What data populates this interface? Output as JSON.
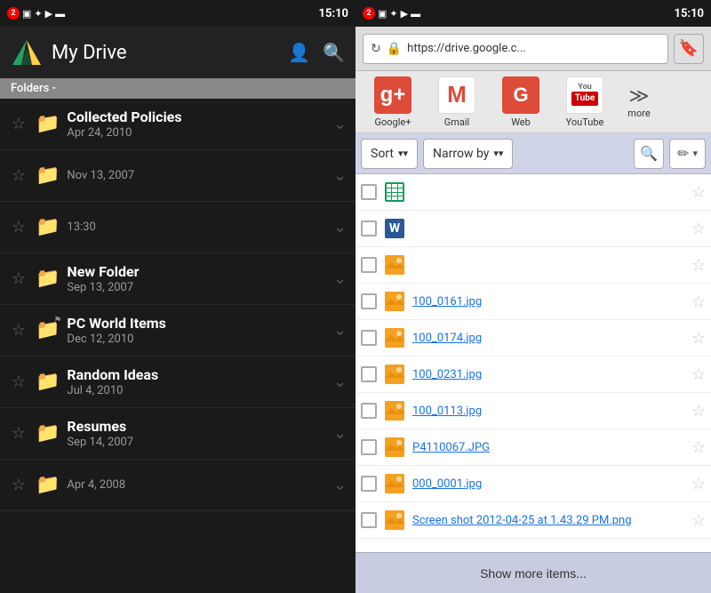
{
  "left": {
    "status_bar": {
      "badge": "2",
      "time": "15:10"
    },
    "header": {
      "title": "My Drive"
    },
    "folders_label": "Folders -",
    "folders": [
      {
        "name": "Collected Policies",
        "date": "Apr 24, 2010",
        "starred": false,
        "flagged": false
      },
      {
        "name": "",
        "date": "Nov 13, 2007",
        "starred": false,
        "flagged": false
      },
      {
        "name": "",
        "date": "13:30",
        "starred": false,
        "flagged": false
      },
      {
        "name": "New Folder",
        "date": "Sep 13, 2007",
        "starred": false,
        "flagged": false
      },
      {
        "name": "PC World Items",
        "date": "Dec 12, 2010",
        "starred": false,
        "flagged": true
      },
      {
        "name": "Random Ideas",
        "date": "Jul 4, 2010",
        "starred": false,
        "flagged": false
      },
      {
        "name": "Resumes",
        "date": "Sep 14, 2007",
        "starred": false,
        "flagged": false
      },
      {
        "name": "",
        "date": "Apr 4, 2008",
        "starred": false,
        "flagged": false
      }
    ]
  },
  "right": {
    "status_bar": {
      "badge": "2",
      "time": "15:10"
    },
    "browser": {
      "url": "https://drive.google.c...",
      "url_icon": "🔒"
    },
    "bookmarks": [
      {
        "id": "gplus",
        "label": "Google+"
      },
      {
        "id": "gmail",
        "label": "Gmail"
      },
      {
        "id": "web",
        "label": "Web"
      },
      {
        "id": "youtube",
        "label": "YouTube"
      },
      {
        "id": "more",
        "label": "more"
      }
    ],
    "toolbar": {
      "sort_label": "Sort",
      "narrow_label": "Narrow by"
    },
    "files": [
      {
        "type": "sheets",
        "name": ""
      },
      {
        "type": "word",
        "name": ""
      },
      {
        "type": "image",
        "name": ""
      },
      {
        "type": "image",
        "name": "100_0161.jpg"
      },
      {
        "type": "image",
        "name": "100_0174.jpg"
      },
      {
        "type": "image",
        "name": "100_0231.jpg"
      },
      {
        "type": "image",
        "name": "100_0113.jpg"
      },
      {
        "type": "image",
        "name": "P4110067.JPG"
      },
      {
        "type": "image",
        "name": "000_0001.jpg"
      },
      {
        "type": "image",
        "name": "Screen shot 2012-04-25 at 1.43.29 PM.png"
      }
    ],
    "show_more": "Show more items..."
  }
}
